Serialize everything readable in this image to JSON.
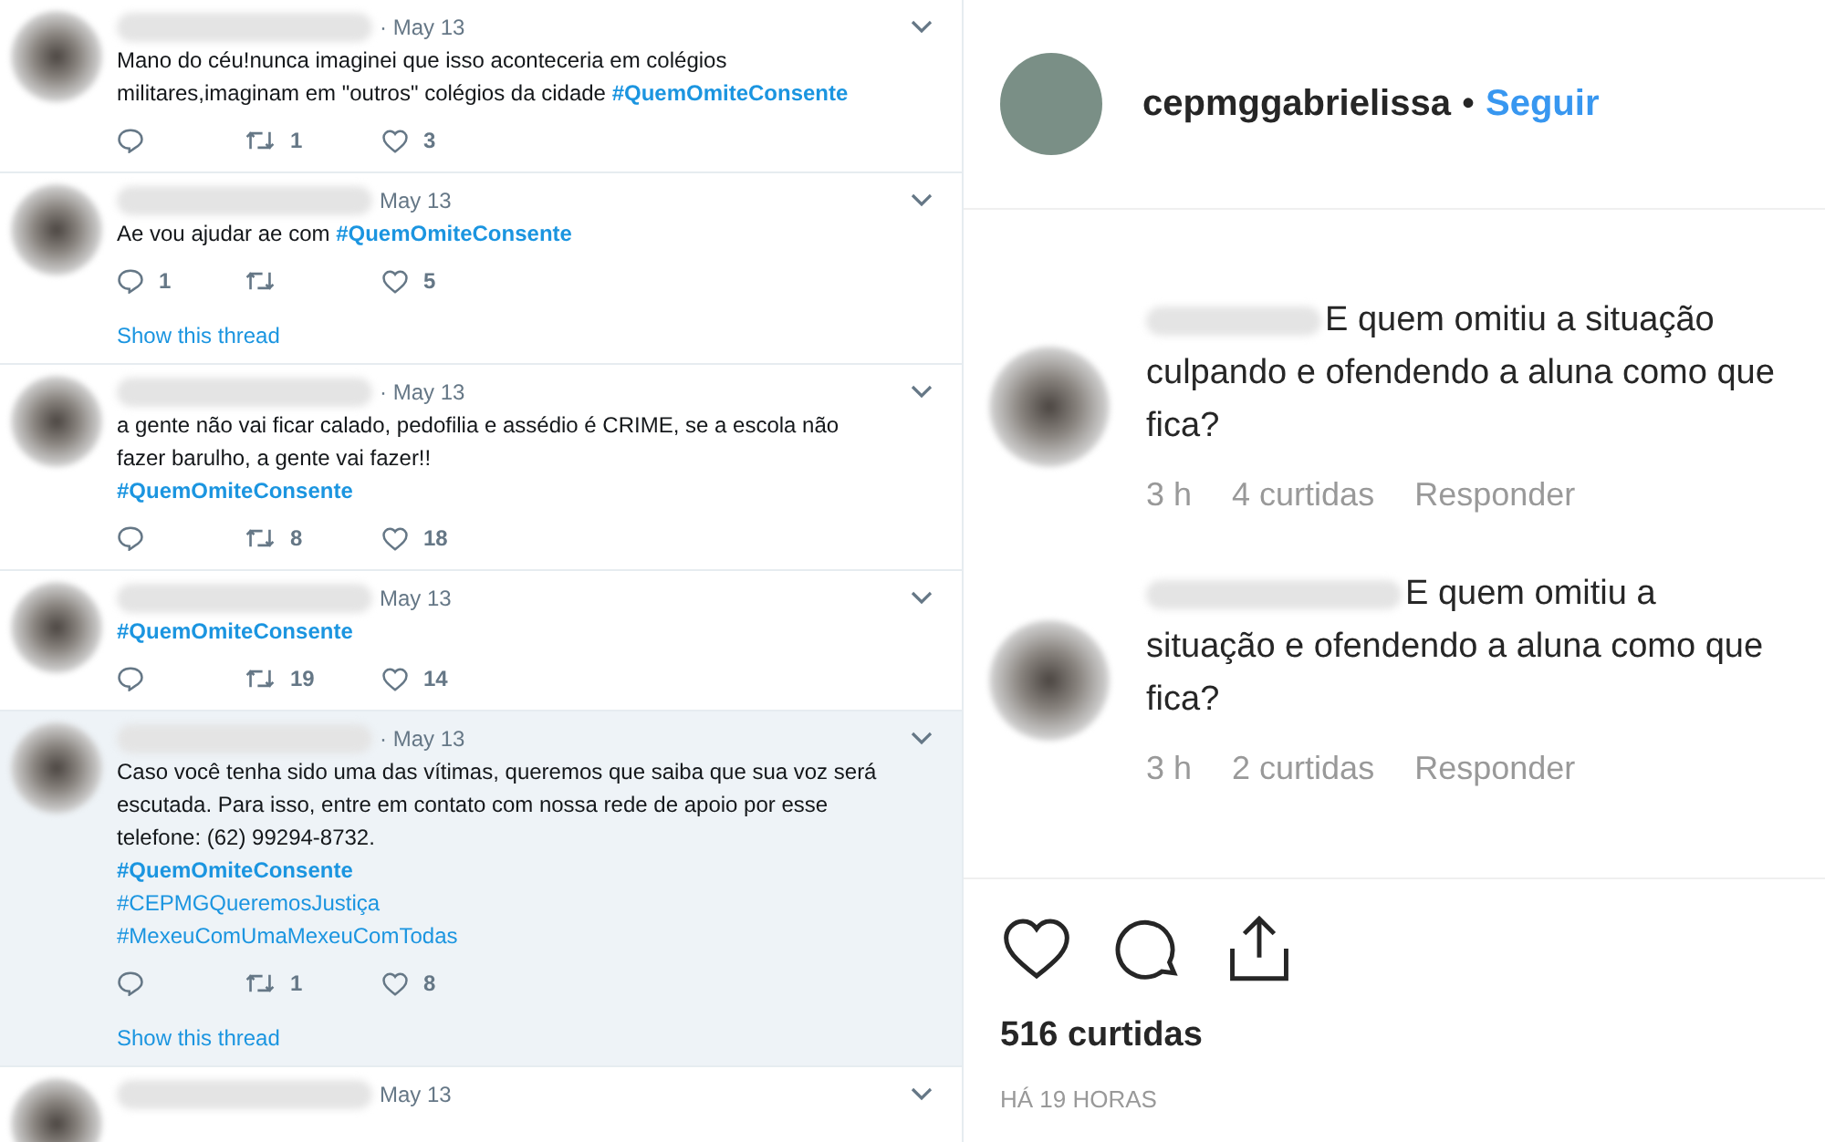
{
  "tweets": [
    {
      "date": "· May 13",
      "highlighted": false,
      "paragraphs": [
        [
          {
            "kind": "plain",
            "text": "Mano do céu!nunca imaginei que isso aconteceria em colégios militares,imaginam em \"outros\" colégios da cidade "
          },
          {
            "kind": "tag",
            "text": "#QuemOmiteConsente",
            "bold": true
          }
        ]
      ],
      "retweets": "1",
      "likes": "3"
    },
    {
      "date": "May 13",
      "highlighted": false,
      "paragraphs": [
        [
          {
            "kind": "plain",
            "text": "Ae vou ajudar ae com "
          },
          {
            "kind": "tag",
            "text": "#QuemOmiteConsente",
            "bold": true
          }
        ]
      ],
      "replies": "1",
      "likes": "5",
      "thread": "Show this thread"
    },
    {
      "date": "· May 13",
      "highlighted": false,
      "paragraphs": [
        [
          {
            "kind": "plain",
            "text": "a gente não vai ficar calado, pedofilia e assédio é CRIME, se a escola não fazer barulho, a gente vai fazer!!"
          }
        ],
        [
          {
            "kind": "tag",
            "text": "#QuemOmiteConsente",
            "bold": true
          }
        ]
      ],
      "retweets": "8",
      "likes": "18"
    },
    {
      "date": "May 13",
      "highlighted": false,
      "paragraphs": [
        [
          {
            "kind": "tag",
            "text": "#QuemOmiteConsente",
            "bold": true
          }
        ]
      ],
      "retweets": "19",
      "likes": "14"
    },
    {
      "date": "· May 13",
      "highlighted": true,
      "paragraphs": [
        [
          {
            "kind": "plain",
            "text": "Caso você tenha sido uma das vítimas, queremos que saiba que sua voz será escutada. Para isso, entre em contato com nossa rede de apoio por esse telefone: (62) 99294-8732."
          }
        ],
        [
          {
            "kind": "tag",
            "text": "#QuemOmiteConsente",
            "bold": true
          }
        ],
        [
          {
            "kind": "tag",
            "text": "#CEPMGQueremosJustiça",
            "bold": false
          }
        ],
        [
          {
            "kind": "tag",
            "text": "#MexeuComUmaMexeuComTodas",
            "bold": false
          }
        ]
      ],
      "retweets": "1",
      "likes": "8",
      "thread": "Show this thread"
    },
    {
      "date": "May 13",
      "highlighted": false
    }
  ],
  "post": {
    "username": "cepmggabrielissa",
    "separator": "•",
    "follow": "Seguir",
    "comments": [
      {
        "text": "E quem omitiu a situação culpando e ofendendo a aluna como que fica?",
        "time": "3 h",
        "likes": "4 curtidas",
        "reply": "Responder"
      },
      {
        "text": "E quem omitiu a situação e ofendendo a aluna como que fica?",
        "time": "3 h",
        "likes": "2 curtidas",
        "reply": "Responder"
      }
    ],
    "like_count": "516 curtidas",
    "posted": "HÁ 19 HORAS"
  }
}
